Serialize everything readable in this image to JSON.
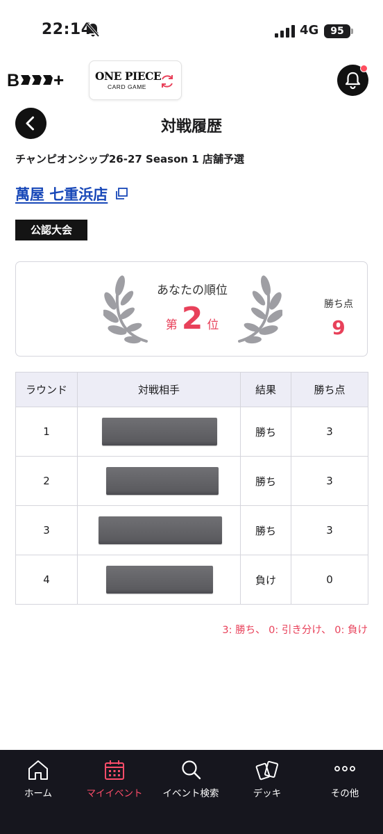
{
  "status_bar": {
    "time": "22:14",
    "network": "4G",
    "battery": "95"
  },
  "header": {
    "brand_logo_text": "B CG+",
    "game_logo": {
      "title": "ONE PIECE",
      "subtitle": "CARD GAME"
    }
  },
  "page": {
    "title": "対戦履歴",
    "event_name": "チャンピオンシップ26-27 Season 1 店舗予選",
    "store_name": "萬屋 七重浜店",
    "badge": "公認大会"
  },
  "rank_card": {
    "caption": "あなたの順位",
    "rank_prefix": "第",
    "rank": "2",
    "rank_suffix": "位",
    "points_label": "勝ち点",
    "points": "9"
  },
  "table": {
    "headers": [
      "ラウンド",
      "対戦相手",
      "結果",
      "勝ち点"
    ],
    "rows": [
      {
        "round": "1",
        "result": "勝ち",
        "points": "3"
      },
      {
        "round": "2",
        "result": "勝ち",
        "points": "3"
      },
      {
        "round": "3",
        "result": "勝ち",
        "points": "3"
      },
      {
        "round": "4",
        "result": "負け",
        "points": "0"
      }
    ]
  },
  "legend_note": "3: 勝ち、 0: 引き分け、 0: 負け",
  "bottom_nav": {
    "items": [
      {
        "label": "ホーム",
        "icon": "home-icon"
      },
      {
        "label": "マイイベント",
        "icon": "calendar-icon",
        "active": true
      },
      {
        "label": "イベント検索",
        "icon": "search-icon"
      },
      {
        "label": "デッキ",
        "icon": "cards-icon"
      },
      {
        "label": "その他",
        "icon": "more-icon"
      }
    ]
  },
  "colors": {
    "accent": "#e8415a",
    "link": "#1747b8",
    "nav_bg": "#16161e",
    "nav_active": "#ff4d6a"
  }
}
